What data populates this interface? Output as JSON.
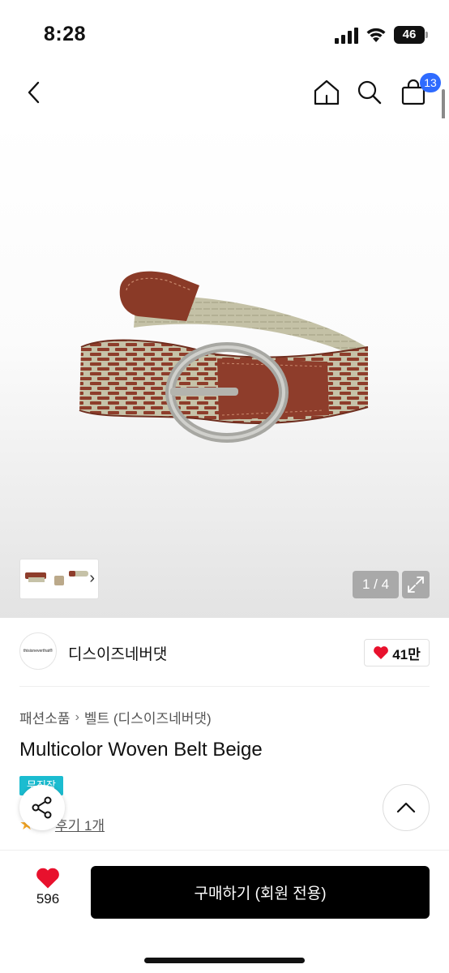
{
  "status_bar": {
    "time": "8:28",
    "battery": "46"
  },
  "nav": {
    "cart_count": "13",
    "icons": [
      "back-arrow-icon",
      "home-icon",
      "search-icon",
      "shopping-bag-icon"
    ]
  },
  "gallery": {
    "counter": "1 / 4"
  },
  "brand": {
    "logo_text": "thisisneverthat®",
    "name": "디스이즈네버댓",
    "likes": "41만"
  },
  "product": {
    "breadcrumb": [
      "패션소품",
      "벨트 (디스이즈네버댓)"
    ],
    "title": "Multicolor Woven Belt Beige",
    "badge": "무진장",
    "reviews": "후기 1개"
  },
  "bottom": {
    "wish_count": "596",
    "buy_label": "구매하기 (회원 전용)"
  },
  "colors": {
    "cart_badge": "#2f6bff",
    "free_ship_badge": "#1bbcd0",
    "heart": "#e8112d",
    "buy_button": "#000000",
    "belt_leather": "#8e3d2b",
    "belt_weave": "#b7b89a",
    "buckle": "#b9b9b4"
  }
}
